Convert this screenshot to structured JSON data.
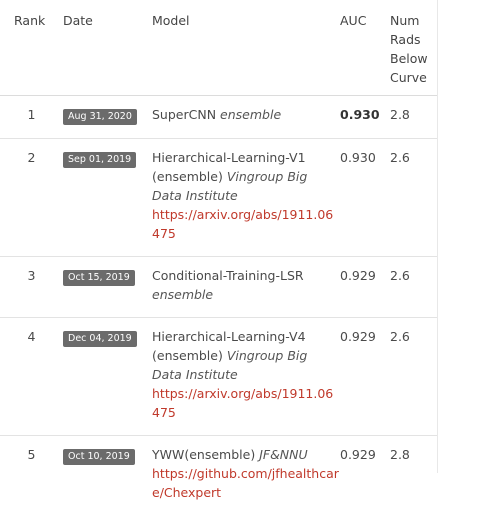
{
  "columns": {
    "rank": "Rank",
    "date": "Date",
    "model": "Model",
    "auc": "AUC",
    "rads_line1": "Num",
    "rads_line2": "Rads",
    "rads_line3": "Below",
    "rads_line4": "Curve"
  },
  "rows": [
    {
      "rank": "1",
      "date": "Aug 31, 2020",
      "model": "SuperCNN",
      "org": "ensemble",
      "link": "",
      "auc": "0.930",
      "rads": "2.8"
    },
    {
      "rank": "2",
      "date": "Sep 01, 2019",
      "model": "Hierarchical-Learning-V1 (ensemble)",
      "org": "Vingroup Big Data Institute",
      "link": "https://arxiv.org/abs/1911.06475",
      "auc": "0.930",
      "rads": "2.6"
    },
    {
      "rank": "3",
      "date": "Oct 15, 2019",
      "model": "Conditional-Training-LSR",
      "org": "ensemble",
      "link": "",
      "auc": "0.929",
      "rads": "2.6"
    },
    {
      "rank": "4",
      "date": "Dec 04, 2019",
      "model": "Hierarchical-Learning-V4 (ensemble)",
      "org": "Vingroup Big Data Institute",
      "link": "https://arxiv.org/abs/1911.06475",
      "auc": "0.929",
      "rads": "2.6"
    },
    {
      "rank": "5",
      "date": "Oct 10, 2019",
      "model": "YWW(ensemble)",
      "org": "JF&NNU",
      "link": "https://github.com/jfhealthcare/Chexpert",
      "auc": "0.929",
      "rads": "2.8"
    }
  ]
}
